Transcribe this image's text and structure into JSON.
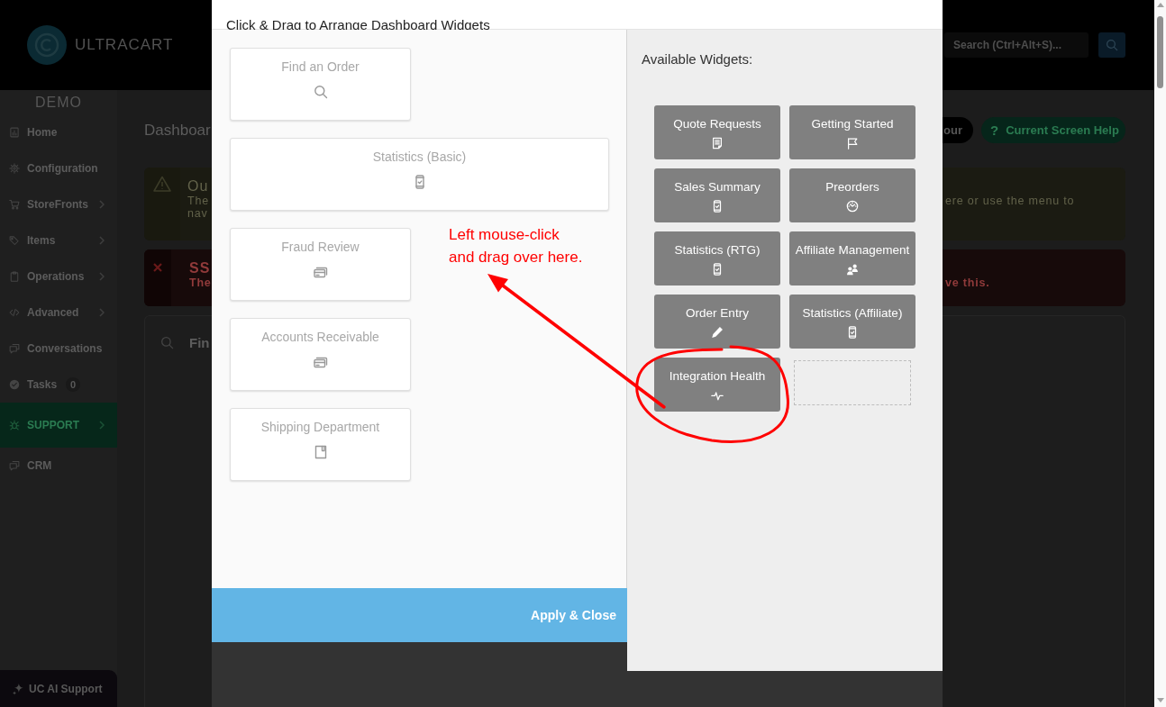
{
  "header": {
    "logo_text": "ULTRACART",
    "search": {
      "placeholder": "Search (Ctrl+Alt+S)..."
    }
  },
  "sidebar": {
    "account": "DEMO",
    "items": [
      {
        "label": "Home",
        "has_submenu": false,
        "highlighted": false
      },
      {
        "label": "Configuration",
        "has_submenu": false,
        "highlighted": false
      },
      {
        "label": "StoreFronts",
        "has_submenu": true,
        "highlighted": false
      },
      {
        "label": "Items",
        "has_submenu": true,
        "highlighted": false
      },
      {
        "label": "Operations",
        "has_submenu": true,
        "highlighted": false
      },
      {
        "label": "Advanced",
        "has_submenu": true,
        "highlighted": false
      },
      {
        "label": "Conversations",
        "has_submenu": false,
        "highlighted": false
      },
      {
        "label": "Tasks",
        "has_submenu": false,
        "highlighted": false,
        "badge": "0"
      },
      {
        "label": "SUPPORT",
        "has_submenu": true,
        "highlighted": true
      },
      {
        "label": "CRM",
        "has_submenu": false,
        "highlighted": false
      }
    ],
    "ai_button": "UC AI Support"
  },
  "page": {
    "title": "Dashboar",
    "tour_button": "our",
    "help_button": {
      "icon": "?",
      "label": "Current Screen Help"
    },
    "alerts": [
      {
        "kind": "warning",
        "title": "Ou",
        "lines": [
          "The",
          "nav"
        ],
        "line_end": "ere or use the menu to"
      },
      {
        "kind": "error",
        "title": "SS",
        "lines": [
          "The"
        ],
        "line_end": "ve this."
      }
    ],
    "card": {
      "title": "Fin"
    }
  },
  "dialog": {
    "title": "Click & Drag to Arrange Dashboard Widgets",
    "dashboard_widgets": [
      {
        "label": "Find an Order",
        "wide": false
      },
      {
        "label": "Statistics (Basic)",
        "wide": true
      },
      {
        "label": "Fraud Review",
        "wide": false
      },
      {
        "label": "Accounts Receivable",
        "wide": false
      },
      {
        "label": "Shipping Department",
        "wide": false
      }
    ],
    "apply_button": "Apply & Close",
    "available_title": "Available Widgets:",
    "available_widgets": [
      {
        "label": "Quote Requests"
      },
      {
        "label": "Getting Started"
      },
      {
        "label": "Sales Summary"
      },
      {
        "label": "Preorders"
      },
      {
        "label": "Statistics (RTG)"
      },
      {
        "label": "Affiliate Management"
      },
      {
        "label": "Order Entry"
      },
      {
        "label": "Statistics (Affiliate)"
      },
      {
        "label": "Integration Health"
      }
    ],
    "drop_placeholder": true
  },
  "annotation": {
    "lines": [
      "Left mouse-click",
      "and drag over here."
    ]
  }
}
